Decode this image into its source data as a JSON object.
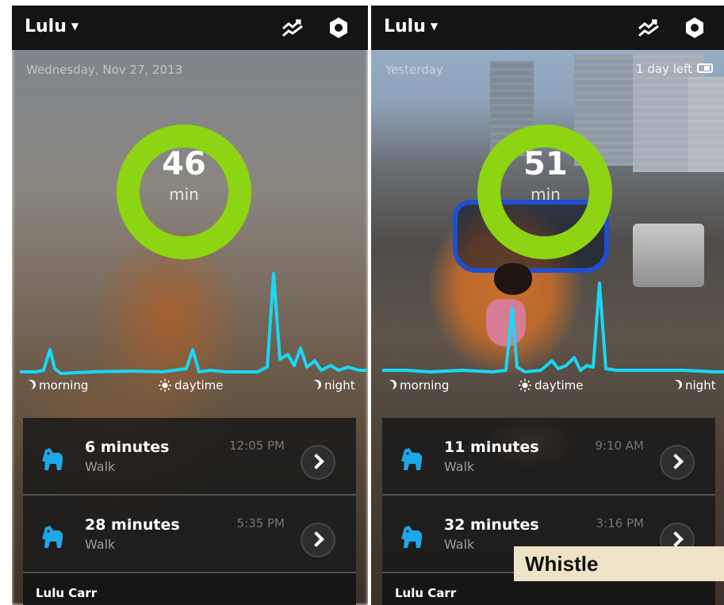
{
  "left_screen": {
    "pet_name": "Lulu",
    "date": "Wednesday, Nov 27, 2013",
    "ring": {
      "value": "46",
      "unit": "min"
    },
    "labels": {
      "morning": "morning",
      "daytime": "daytime",
      "night": "night"
    },
    "activities": [
      {
        "duration": "6 minutes",
        "type": "Walk",
        "time": "12:05 PM"
      },
      {
        "duration": "28 minutes",
        "type": "Walk",
        "time": "5:35 PM"
      }
    ],
    "owner": "Lulu Carr"
  },
  "right_screen": {
    "pet_name": "Lulu",
    "date": "Yesterday",
    "days_left": "1 day left",
    "ring": {
      "value": "51",
      "unit": "min"
    },
    "labels": {
      "morning": "morning",
      "daytime": "daytime",
      "night": "night"
    },
    "activities": [
      {
        "duration": "11 minutes",
        "type": "Walk",
        "time": "9:10 AM"
      },
      {
        "duration": "32 minutes",
        "type": "Walk",
        "time": "3:16 PM"
      }
    ],
    "owner": "Lulu Carr"
  },
  "watermark": "Whistle",
  "colors": {
    "ring": "#8dd412",
    "graph_line": "#18d8f5",
    "icon_blue": "#1ea7e8",
    "topbar": "#141414"
  },
  "icons": [
    "trend-icon",
    "hexagon-settings-icon",
    "dog-icon",
    "chevron-right-icon",
    "moon-icon",
    "sun-icon",
    "battery-icon"
  ]
}
